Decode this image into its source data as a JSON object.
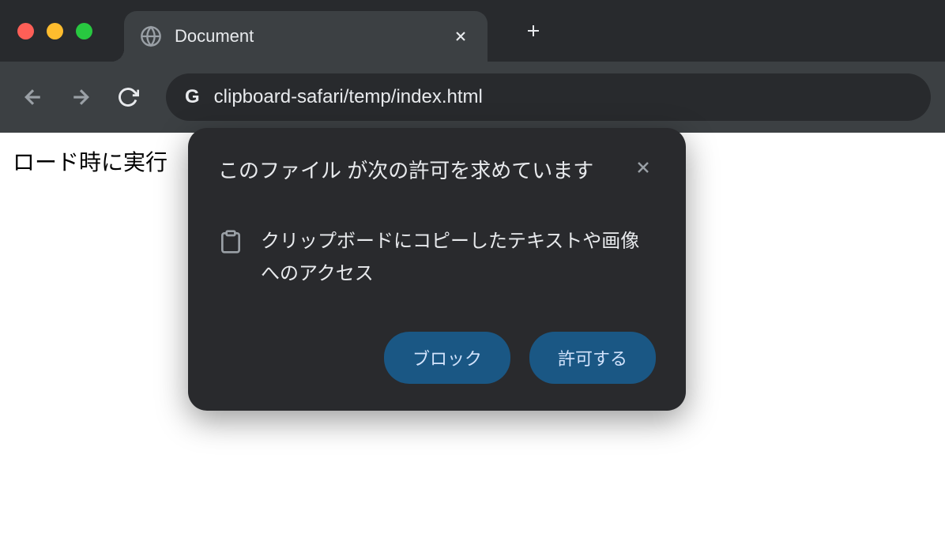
{
  "tab": {
    "title": "Document"
  },
  "address": {
    "url": "clipboard-safari/temp/index.html"
  },
  "page": {
    "text": "ロード時に実行"
  },
  "dialog": {
    "title": "このファイル が次の許可を求めています",
    "message": "クリップボードにコピーしたテキストや画像へのアクセス",
    "block_label": "ブロック",
    "allow_label": "許可する"
  }
}
